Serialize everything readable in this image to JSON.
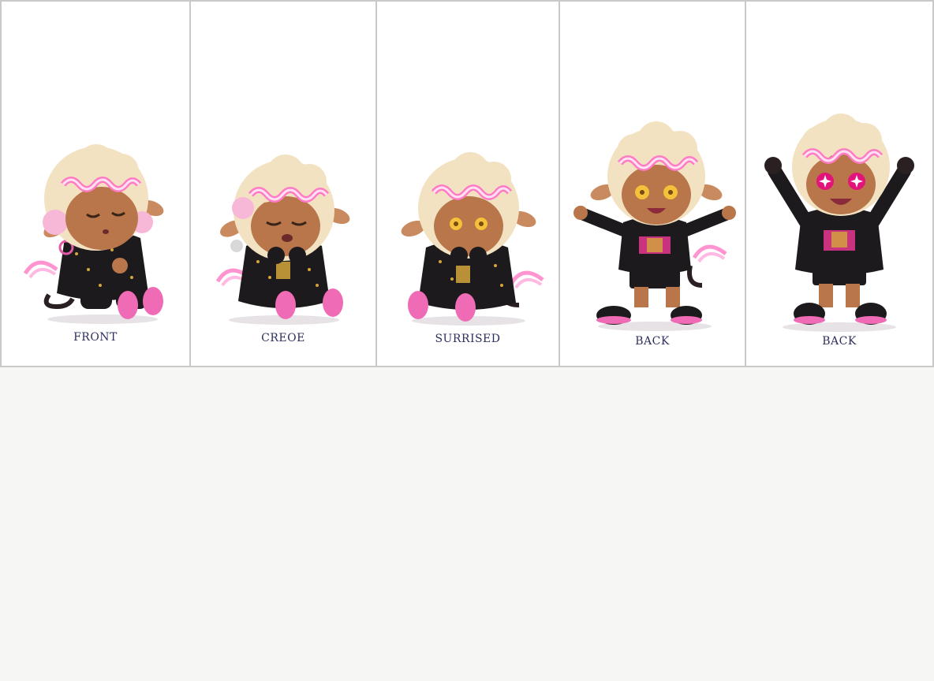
{
  "sheet": {
    "panels": [
      {
        "label": "FRONT",
        "pose": "sitting",
        "expression": "sleepy-eyes-closed"
      },
      {
        "label": "CREOE",
        "pose": "sitting",
        "expression": "crying-hands-to-mouth"
      },
      {
        "label": "SURRISED",
        "pose": "sitting",
        "expression": "surprised-hands-to-mouth"
      },
      {
        "label": "BACK",
        "pose": "walking-arms-out",
        "expression": "happy-open-mouth"
      },
      {
        "label": "BACK",
        "pose": "standing-arms-raised",
        "expression": "excited-star-eyes"
      }
    ]
  },
  "colors": {
    "background": "#f6f6f5",
    "panel": "#ffffff",
    "border": "#c9c9c9",
    "caption": "#2c2f5e",
    "skin": "#b8764a",
    "hair_cream": "#f3e2c2",
    "hair_pink": "#ff7ac4",
    "jacket": "#1c1a1c",
    "gold": "#d4a63a",
    "shoe_pink": "#f06bb5"
  }
}
